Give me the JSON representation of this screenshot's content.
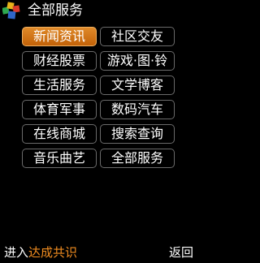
{
  "header": {
    "title": "全部服务",
    "logo_icon": "colored-blocks-logo-icon"
  },
  "menu": {
    "selected_index": 0,
    "items": [
      {
        "label": "新闻资讯"
      },
      {
        "label": "社区交友"
      },
      {
        "label": "财经股票"
      },
      {
        "label": "游戏·图·铃"
      },
      {
        "label": "生活服务"
      },
      {
        "label": "文学博客"
      },
      {
        "label": "体育军事"
      },
      {
        "label": "数码汽车"
      },
      {
        "label": "在线商城"
      },
      {
        "label": "搜索查询"
      },
      {
        "label": "音乐曲艺"
      },
      {
        "label": "全部服务"
      }
    ]
  },
  "softkeys": {
    "left_prefix": "进入",
    "left_highlight": "达成共识",
    "right": "返回"
  },
  "colors": {
    "background": "#000000",
    "selected_button": "#d87418",
    "highlight_text": "#f08c20",
    "button_border": "#6b6b6b"
  }
}
